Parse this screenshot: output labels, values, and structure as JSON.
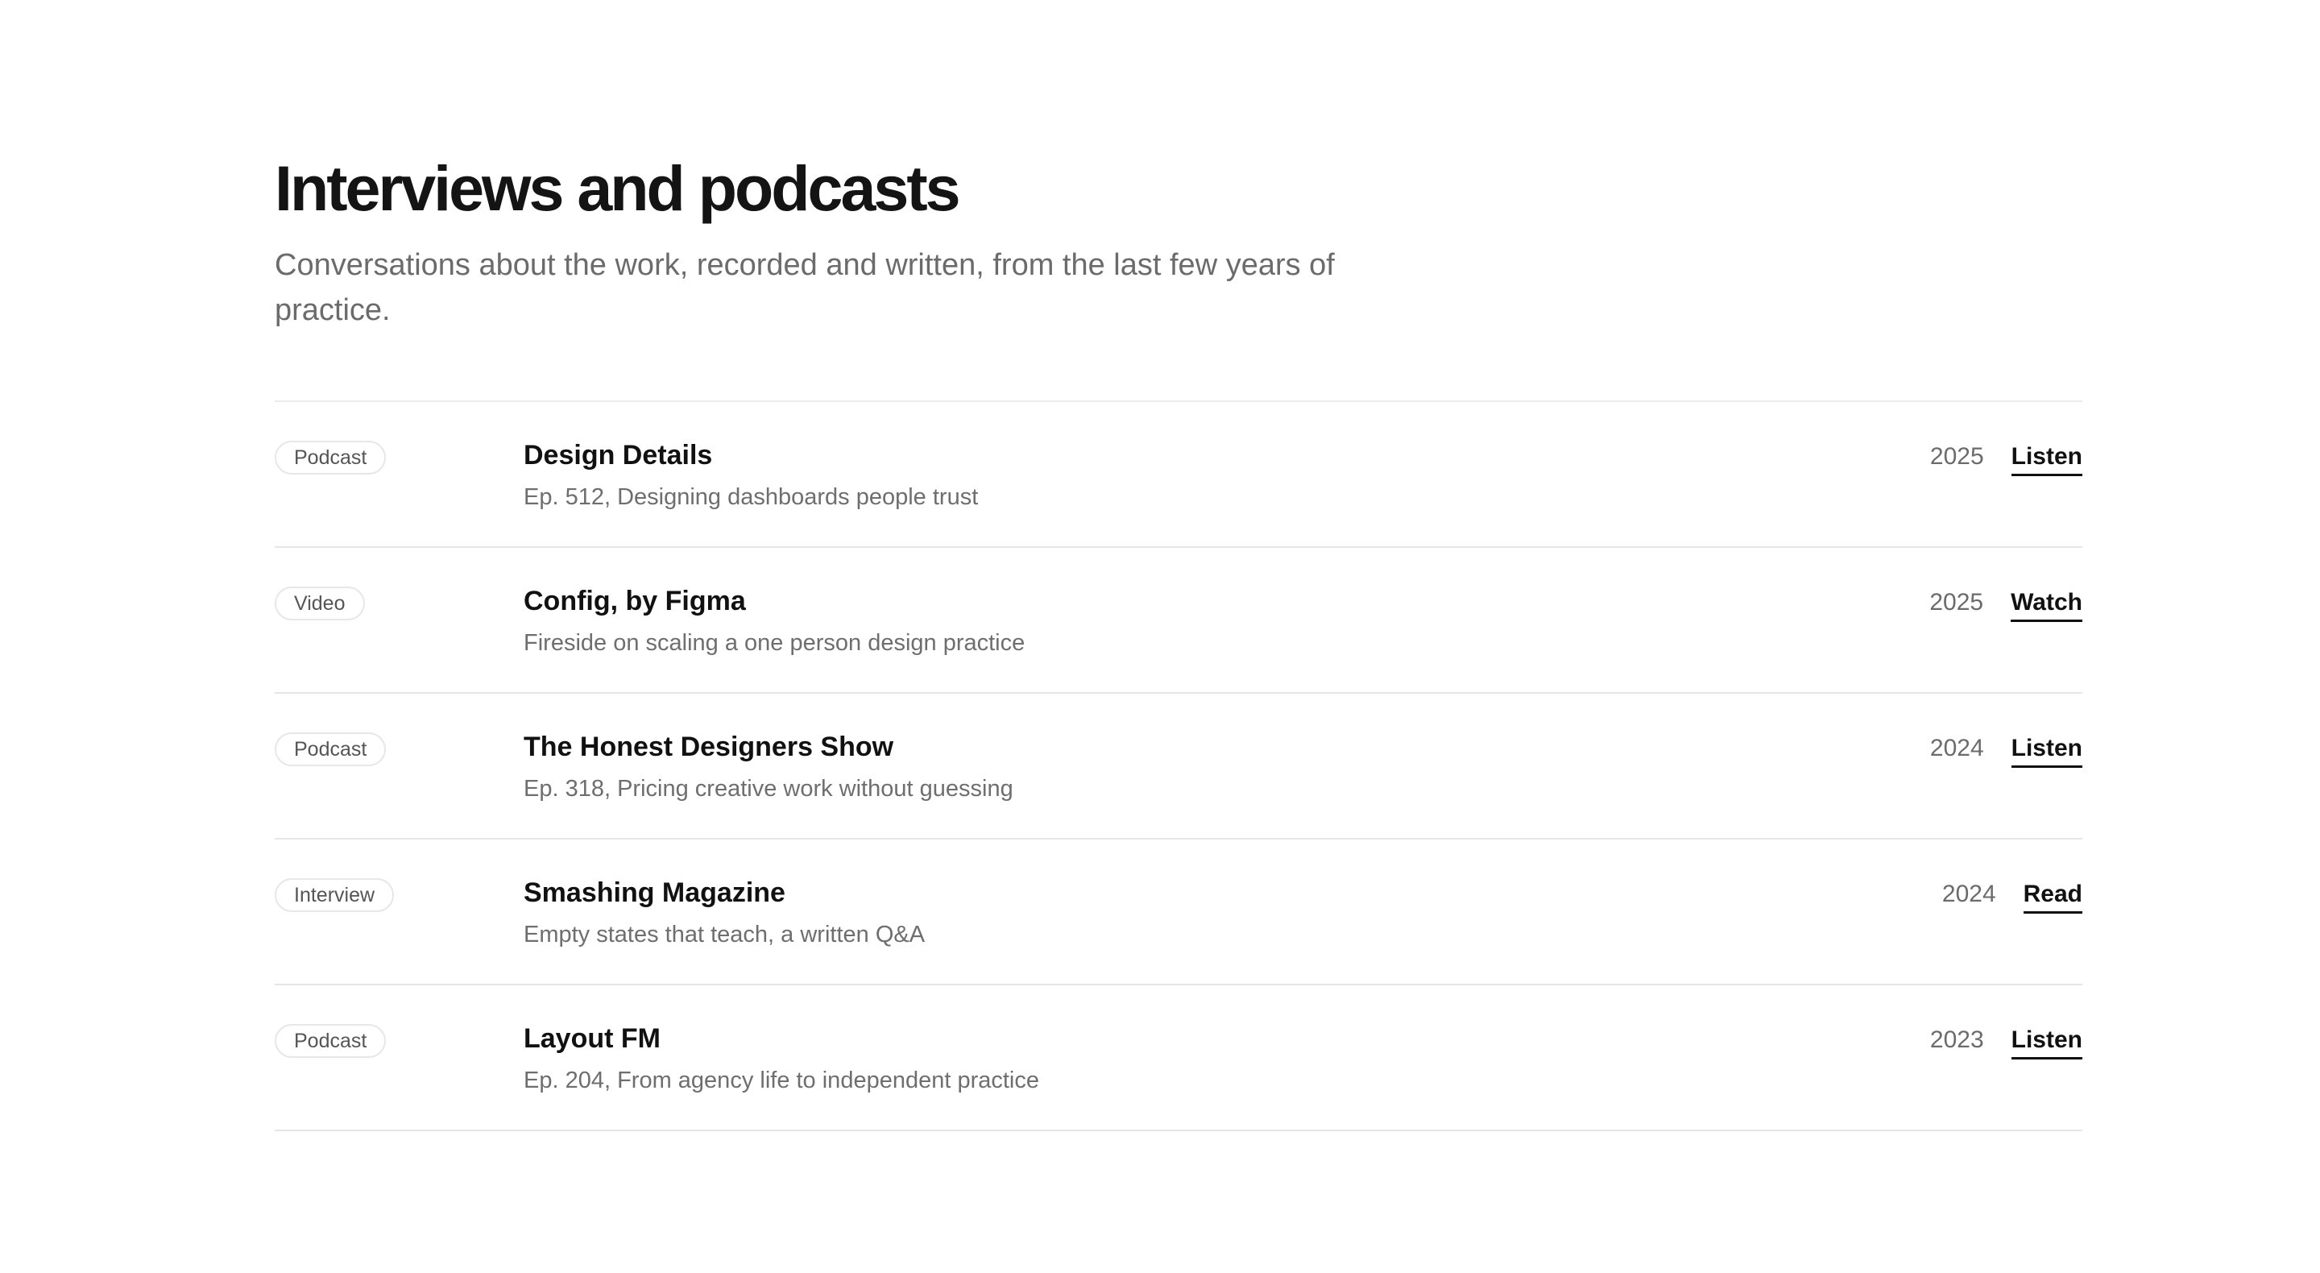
{
  "header": {
    "title": "Interviews and podcasts",
    "subtitle": "Conversations about the work, recorded and written, from the last few years of practice."
  },
  "items": [
    {
      "type": "Podcast",
      "title": "Design Details",
      "description": "Ep. 512, Designing dashboards people trust",
      "year": "2025",
      "action": "Listen"
    },
    {
      "type": "Video",
      "title": "Config, by Figma",
      "description": "Fireside on scaling a one person design practice",
      "year": "2025",
      "action": "Watch"
    },
    {
      "type": "Podcast",
      "title": "The Honest Designers Show",
      "description": "Ep. 318, Pricing creative work without guessing",
      "year": "2024",
      "action": "Listen"
    },
    {
      "type": "Interview",
      "title": "Smashing Magazine",
      "description": "Empty states that teach, a written Q&A",
      "year": "2024",
      "action": "Read"
    },
    {
      "type": "Podcast",
      "title": "Layout FM",
      "description": "Ep. 204, From agency life to independent practice",
      "year": "2023",
      "action": "Listen"
    }
  ],
  "colors": {
    "text": "#111111",
    "muted": "#6b6b6b",
    "divider": "#e6e6e6",
    "background": "#ffffff"
  }
}
